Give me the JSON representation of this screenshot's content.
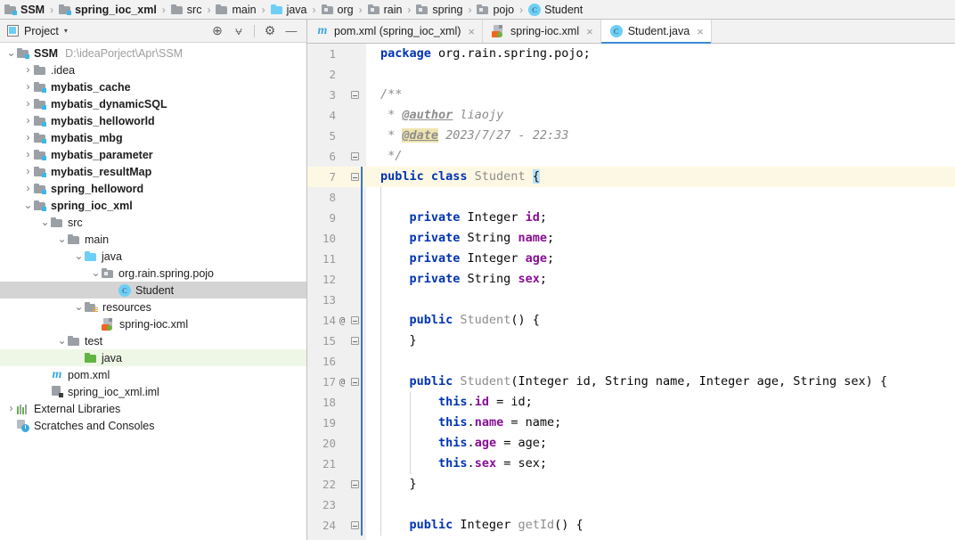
{
  "breadcrumb": {
    "items": [
      {
        "label": "SSM",
        "icon": "module-icon",
        "bold": true
      },
      {
        "label": "spring_ioc_xml",
        "icon": "module-icon",
        "bold": true
      },
      {
        "label": "src",
        "icon": "folder-icon",
        "bold": false
      },
      {
        "label": "main",
        "icon": "folder-icon",
        "bold": false
      },
      {
        "label": "java",
        "icon": "folder-blue-icon",
        "bold": false
      },
      {
        "label": "org",
        "icon": "package-icon",
        "bold": false
      },
      {
        "label": "rain",
        "icon": "package-icon",
        "bold": false
      },
      {
        "label": "spring",
        "icon": "package-icon",
        "bold": false
      },
      {
        "label": "pojo",
        "icon": "package-icon",
        "bold": false
      },
      {
        "label": "Student",
        "icon": "class-icon",
        "bold": false
      }
    ],
    "separator": "›"
  },
  "tool_window": {
    "title": "Project",
    "caret": "▾",
    "actions": [
      {
        "name": "locate-icon",
        "glyph": "⊕"
      },
      {
        "name": "collapse-all-icon",
        "glyph": "⩝"
      },
      {
        "name": "settings-gear-icon",
        "glyph": "⚙"
      },
      {
        "name": "hide-icon",
        "glyph": "—"
      }
    ],
    "tree": [
      {
        "depth": 0,
        "arrow": "⌄",
        "icon": "module-icon",
        "label": "SSM",
        "bold": true,
        "path": "D:\\ideaPorject\\Apr\\SSM",
        "state": ""
      },
      {
        "depth": 1,
        "arrow": "›",
        "icon": "folder-icon",
        "label": ".idea",
        "bold": false,
        "path": "",
        "state": ""
      },
      {
        "depth": 1,
        "arrow": "›",
        "icon": "module-icon",
        "label": "mybatis_cache",
        "bold": true,
        "path": "",
        "state": ""
      },
      {
        "depth": 1,
        "arrow": "›",
        "icon": "module-icon",
        "label": "mybatis_dynamicSQL",
        "bold": true,
        "path": "",
        "state": ""
      },
      {
        "depth": 1,
        "arrow": "›",
        "icon": "module-icon",
        "label": "mybatis_helloworld",
        "bold": true,
        "path": "",
        "state": ""
      },
      {
        "depth": 1,
        "arrow": "›",
        "icon": "module-icon",
        "label": "mybatis_mbg",
        "bold": true,
        "path": "",
        "state": ""
      },
      {
        "depth": 1,
        "arrow": "›",
        "icon": "module-icon",
        "label": "mybatis_parameter",
        "bold": true,
        "path": "",
        "state": ""
      },
      {
        "depth": 1,
        "arrow": "›",
        "icon": "module-icon",
        "label": "mybatis_resultMap",
        "bold": true,
        "path": "",
        "state": ""
      },
      {
        "depth": 1,
        "arrow": "›",
        "icon": "module-icon",
        "label": "spring_helloword",
        "bold": true,
        "path": "",
        "state": ""
      },
      {
        "depth": 1,
        "arrow": "⌄",
        "icon": "module-icon",
        "label": "spring_ioc_xml",
        "bold": true,
        "path": "",
        "state": ""
      },
      {
        "depth": 2,
        "arrow": "⌄",
        "icon": "folder-icon",
        "label": "src",
        "bold": false,
        "path": "",
        "state": ""
      },
      {
        "depth": 3,
        "arrow": "⌄",
        "icon": "folder-icon",
        "label": "main",
        "bold": false,
        "path": "",
        "state": ""
      },
      {
        "depth": 4,
        "arrow": "⌄",
        "icon": "folder-blue-icon",
        "label": "java",
        "bold": false,
        "path": "",
        "state": ""
      },
      {
        "depth": 5,
        "arrow": "⌄",
        "icon": "package-icon",
        "label": "org.rain.spring.pojo",
        "bold": false,
        "path": "",
        "state": ""
      },
      {
        "depth": 6,
        "arrow": "",
        "icon": "class-icon",
        "label": "Student",
        "bold": false,
        "path": "",
        "state": "selected"
      },
      {
        "depth": 4,
        "arrow": "⌄",
        "icon": "folder-resources-icon",
        "label": "resources",
        "bold": false,
        "path": "",
        "state": ""
      },
      {
        "depth": 5,
        "arrow": "",
        "icon": "spring-xml-icon",
        "label": "spring-ioc.xml",
        "bold": false,
        "path": "",
        "state": ""
      },
      {
        "depth": 3,
        "arrow": "⌄",
        "icon": "folder-icon",
        "label": "test",
        "bold": false,
        "path": "",
        "state": ""
      },
      {
        "depth": 4,
        "arrow": "",
        "icon": "folder-green-icon",
        "label": "java",
        "bold": false,
        "path": "",
        "state": "highlighted"
      },
      {
        "depth": 2,
        "arrow": "",
        "icon": "maven-icon",
        "label": "pom.xml",
        "bold": false,
        "path": "",
        "state": ""
      },
      {
        "depth": 2,
        "arrow": "",
        "icon": "iml-icon",
        "label": "spring_ioc_xml.iml",
        "bold": false,
        "path": "",
        "state": ""
      },
      {
        "depth": 0,
        "arrow": "›",
        "icon": "external-libraries-icon",
        "label": "External Libraries",
        "bold": false,
        "path": "",
        "state": ""
      },
      {
        "depth": 0,
        "arrow": "",
        "icon": "scratches-icon",
        "label": "Scratches and Consoles",
        "bold": false,
        "path": "",
        "state": ""
      }
    ]
  },
  "editor": {
    "tabs": [
      {
        "label": "pom.xml (spring_ioc_xml)",
        "icon": "maven-icon",
        "active": false,
        "close": "×"
      },
      {
        "label": "spring-ioc.xml",
        "icon": "spring-xml-icon",
        "active": false,
        "close": "×"
      },
      {
        "label": "Student.java",
        "icon": "class-icon",
        "active": true,
        "close": "×"
      }
    ],
    "caret_line": 7,
    "lines": [
      {
        "num": 1,
        "ann": "",
        "fold": "none",
        "tokens": [
          {
            "t": "package ",
            "c": "kw"
          },
          {
            "t": "org.rain.spring.pojo;",
            "c": "pln"
          }
        ]
      },
      {
        "num": 2,
        "ann": "",
        "fold": "none",
        "tokens": []
      },
      {
        "num": 3,
        "ann": "",
        "fold": "start",
        "tokens": [
          {
            "t": "/**",
            "c": "cmt"
          }
        ]
      },
      {
        "num": 4,
        "ann": "",
        "fold": "line",
        "tokens": [
          {
            "t": " * ",
            "c": "cmt"
          },
          {
            "t": "@author",
            "c": "tag"
          },
          {
            "t": " liaojy",
            "c": "cmt"
          }
        ]
      },
      {
        "num": 5,
        "ann": "",
        "fold": "line",
        "tokens": [
          {
            "t": " * ",
            "c": "cmt"
          },
          {
            "t": "@date",
            "c": "tagh"
          },
          {
            "t": " 2023/7/27 - 22:33",
            "c": "cmt"
          }
        ]
      },
      {
        "num": 6,
        "ann": "",
        "fold": "end",
        "tokens": [
          {
            "t": " */",
            "c": "cmt"
          }
        ]
      },
      {
        "num": 7,
        "ann": "",
        "fold": "class-start",
        "tokens": [
          {
            "t": "public class ",
            "c": "kw"
          },
          {
            "t": "Student",
            "c": "cls"
          },
          {
            "t": " ",
            "c": "pln"
          },
          {
            "t": "{",
            "c": "brace-hl"
          }
        ]
      },
      {
        "num": 8,
        "ann": "",
        "fold": "bar",
        "tokens": []
      },
      {
        "num": 9,
        "ann": "",
        "fold": "bar",
        "tokens": [
          {
            "t": "    ",
            "c": "pln"
          },
          {
            "t": "private ",
            "c": "kw"
          },
          {
            "t": "Integer ",
            "c": "pln"
          },
          {
            "t": "id",
            "c": "fld"
          },
          {
            "t": ";",
            "c": "pln"
          }
        ]
      },
      {
        "num": 10,
        "ann": "",
        "fold": "bar",
        "tokens": [
          {
            "t": "    ",
            "c": "pln"
          },
          {
            "t": "private ",
            "c": "kw"
          },
          {
            "t": "String ",
            "c": "pln"
          },
          {
            "t": "name",
            "c": "fld"
          },
          {
            "t": ";",
            "c": "pln"
          }
        ]
      },
      {
        "num": 11,
        "ann": "",
        "fold": "bar",
        "tokens": [
          {
            "t": "    ",
            "c": "pln"
          },
          {
            "t": "private ",
            "c": "kw"
          },
          {
            "t": "Integer ",
            "c": "pln"
          },
          {
            "t": "age",
            "c": "fld"
          },
          {
            "t": ";",
            "c": "pln"
          }
        ]
      },
      {
        "num": 12,
        "ann": "",
        "fold": "bar",
        "tokens": [
          {
            "t": "    ",
            "c": "pln"
          },
          {
            "t": "private ",
            "c": "kw"
          },
          {
            "t": "String ",
            "c": "pln"
          },
          {
            "t": "sex",
            "c": "fld"
          },
          {
            "t": ";",
            "c": "pln"
          }
        ]
      },
      {
        "num": 13,
        "ann": "",
        "fold": "bar",
        "tokens": []
      },
      {
        "num": 14,
        "ann": "@",
        "fold": "start",
        "tokens": [
          {
            "t": "    ",
            "c": "pln"
          },
          {
            "t": "public ",
            "c": "kw"
          },
          {
            "t": "Student",
            "c": "cls"
          },
          {
            "t": "() {",
            "c": "pln"
          }
        ]
      },
      {
        "num": 15,
        "ann": "",
        "fold": "end",
        "tokens": [
          {
            "t": "    }",
            "c": "pln"
          }
        ]
      },
      {
        "num": 16,
        "ann": "",
        "fold": "bar",
        "tokens": []
      },
      {
        "num": 17,
        "ann": "@",
        "fold": "start",
        "tokens": [
          {
            "t": "    ",
            "c": "pln"
          },
          {
            "t": "public ",
            "c": "kw"
          },
          {
            "t": "Student",
            "c": "cls"
          },
          {
            "t": "(Integer id, String name, Integer age, String sex) {",
            "c": "pln"
          }
        ]
      },
      {
        "num": 18,
        "ann": "",
        "fold": "bar",
        "tokens": [
          {
            "t": "        ",
            "c": "pln"
          },
          {
            "t": "this",
            "c": "kw"
          },
          {
            "t": ".",
            "c": "pln"
          },
          {
            "t": "id",
            "c": "fld"
          },
          {
            "t": " = id;",
            "c": "pln"
          }
        ]
      },
      {
        "num": 19,
        "ann": "",
        "fold": "bar",
        "tokens": [
          {
            "t": "        ",
            "c": "pln"
          },
          {
            "t": "this",
            "c": "kw"
          },
          {
            "t": ".",
            "c": "pln"
          },
          {
            "t": "name",
            "c": "fld"
          },
          {
            "t": " = name;",
            "c": "pln"
          }
        ]
      },
      {
        "num": 20,
        "ann": "",
        "fold": "bar",
        "tokens": [
          {
            "t": "        ",
            "c": "pln"
          },
          {
            "t": "this",
            "c": "kw"
          },
          {
            "t": ".",
            "c": "pln"
          },
          {
            "t": "age",
            "c": "fld"
          },
          {
            "t": " = age;",
            "c": "pln"
          }
        ]
      },
      {
        "num": 21,
        "ann": "",
        "fold": "bar",
        "tokens": [
          {
            "t": "        ",
            "c": "pln"
          },
          {
            "t": "this",
            "c": "kw"
          },
          {
            "t": ".",
            "c": "pln"
          },
          {
            "t": "sex",
            "c": "fld"
          },
          {
            "t": " = sex;",
            "c": "pln"
          }
        ]
      },
      {
        "num": 22,
        "ann": "",
        "fold": "end",
        "tokens": [
          {
            "t": "    }",
            "c": "pln"
          }
        ]
      },
      {
        "num": 23,
        "ann": "",
        "fold": "bar",
        "tokens": []
      },
      {
        "num": 24,
        "ann": "",
        "fold": "start",
        "tokens": [
          {
            "t": "    ",
            "c": "pln"
          },
          {
            "t": "public ",
            "c": "kw"
          },
          {
            "t": "Integer ",
            "c": "pln"
          },
          {
            "t": "getId",
            "c": "cls"
          },
          {
            "t": "() {",
            "c": "pln"
          }
        ]
      }
    ]
  },
  "colors": {
    "accent": "#3c8bd8",
    "caret_line": "#fdf8e3",
    "selection": "#d4d4d4",
    "test_source": "#eef7e6",
    "keyword": "#0033b3",
    "field": "#871094",
    "comment": "#8c8c8c"
  }
}
